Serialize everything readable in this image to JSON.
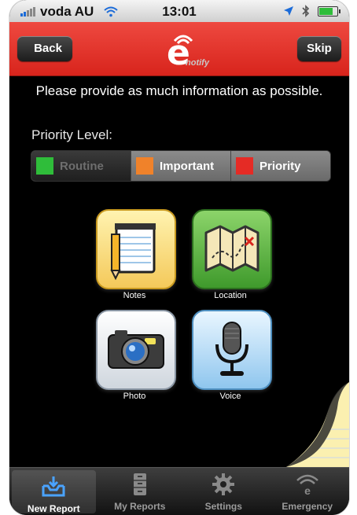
{
  "status": {
    "carrier": "voda AU",
    "time": "13:01"
  },
  "nav": {
    "back_label": "Back",
    "skip_label": "Skip",
    "logo_letter": "e",
    "logo_word": "notify"
  },
  "intro_text": "Please provide as much information as possible.",
  "priority": {
    "label": "Priority Level:",
    "options": [
      {
        "label": "Routine",
        "color": "#2fbd3a"
      },
      {
        "label": "Important",
        "color": "#f0822a"
      },
      {
        "label": "Priority",
        "color": "#e52b25"
      }
    ]
  },
  "tiles": [
    {
      "label": "Notes",
      "icon": "notes-icon"
    },
    {
      "label": "Location",
      "icon": "map-icon"
    },
    {
      "label": "Photo",
      "icon": "camera-icon"
    },
    {
      "label": "Voice",
      "icon": "microphone-icon"
    }
  ],
  "tabs": [
    {
      "label": "New Report",
      "icon": "inbox-download-icon",
      "active": true
    },
    {
      "label": "My Reports",
      "icon": "filing-cabinet-icon",
      "active": false
    },
    {
      "label": "Settings",
      "icon": "gear-icon",
      "active": false
    },
    {
      "label": "Emergency",
      "icon": "broadcast-icon",
      "active": false
    }
  ],
  "colors": {
    "nav_red": "#e3342c",
    "background": "#000000"
  }
}
